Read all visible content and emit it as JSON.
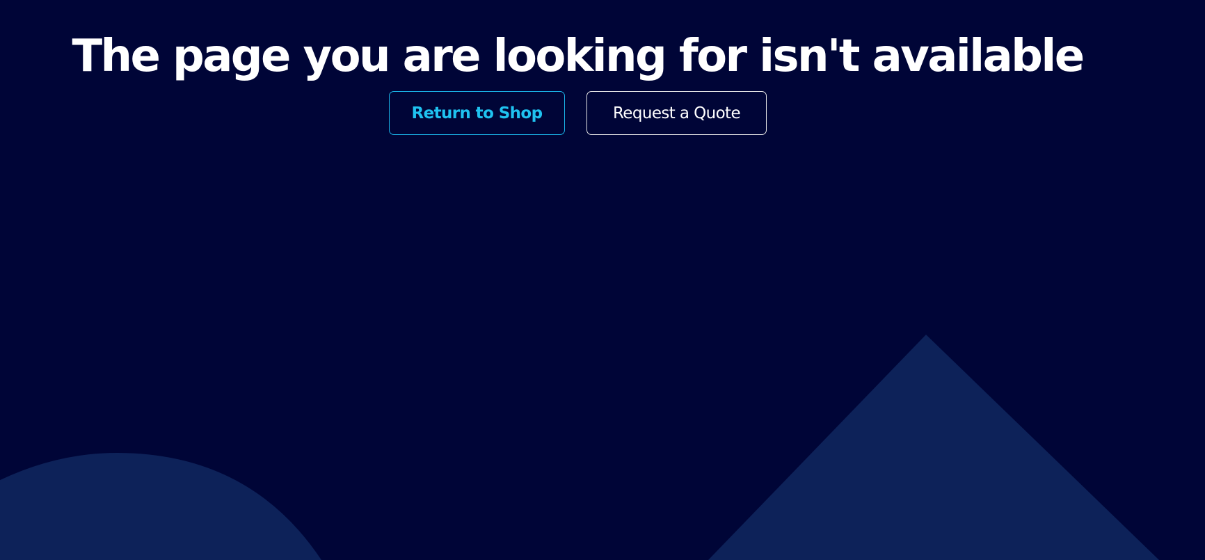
{
  "page": {
    "title": "The page you are looking for isn't available"
  },
  "actions": {
    "return_to_shop": "Return to Shop",
    "request_quote": "Request a Quote"
  },
  "colors": {
    "background": "#000537",
    "shape": "#0d2259",
    "primary_accent": "#1fc2f0",
    "text": "#ffffff"
  }
}
